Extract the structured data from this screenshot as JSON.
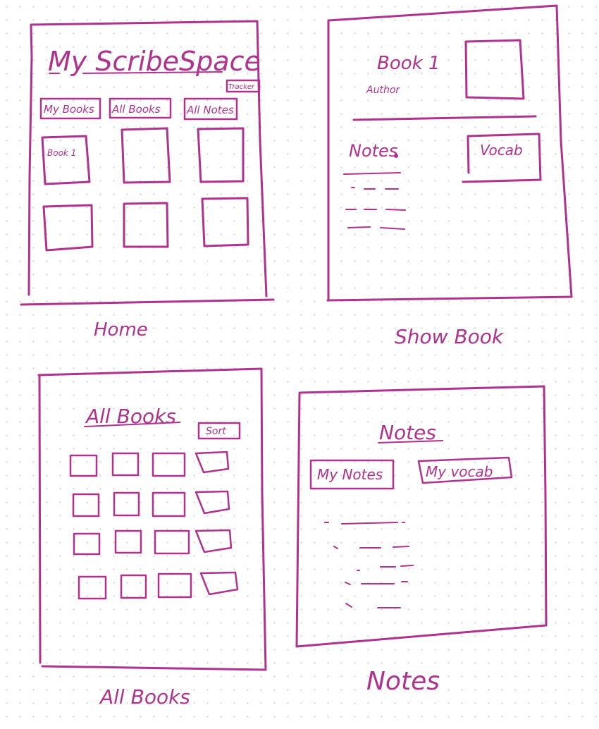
{
  "colors": {
    "ink": "#b0328f",
    "paper": "#ffffff",
    "dots": "#cfcfcf"
  },
  "home": {
    "caption": "Home",
    "title": "My ScribeSpace",
    "tracker_button": "Tracker",
    "nav": [
      "My Books",
      "All Books",
      "All Notes"
    ],
    "first_card_label": "Book 1"
  },
  "show_book": {
    "caption": "Show Book",
    "book_title": "Book 1",
    "author": "Author",
    "notes_heading": "Notes",
    "vocab_label": "Vocab"
  },
  "all_books": {
    "caption": "All Books",
    "heading": "All Books",
    "sort_button": "Sort"
  },
  "notes": {
    "caption": "Notes",
    "heading": "Notes",
    "tabs": [
      "My Notes",
      "My vocab"
    ]
  }
}
